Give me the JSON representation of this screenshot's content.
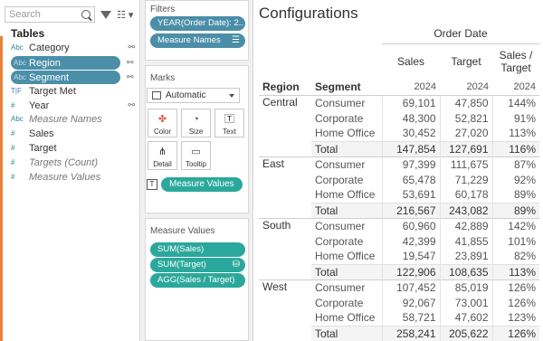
{
  "data_pane": {
    "search_placeholder": "Search",
    "tables_title": "Tables",
    "fields": [
      {
        "type": "Abc",
        "name": "Category",
        "selected": false,
        "italic": false
      },
      {
        "type": "Abc",
        "name": "Region",
        "selected": true,
        "italic": false
      },
      {
        "type": "Abc",
        "name": "Segment",
        "selected": true,
        "italic": false
      },
      {
        "type": "T|F",
        "name": "Target Met",
        "selected": false,
        "italic": false
      },
      {
        "type": "#",
        "name": "Year",
        "selected": false,
        "italic": false
      },
      {
        "type": "Abc",
        "name": "Measure Names",
        "selected": false,
        "italic": true
      },
      {
        "type": "#",
        "name": "Sales",
        "selected": false,
        "italic": false
      },
      {
        "type": "#",
        "name": "Target",
        "selected": false,
        "italic": false
      },
      {
        "type": "#",
        "name": "Targets (Count)",
        "selected": false,
        "italic": true
      },
      {
        "type": "#",
        "name": "Measure Values",
        "selected": false,
        "italic": true
      }
    ]
  },
  "filters": {
    "title": "Filters",
    "items": [
      "YEAR(Order Date): 2..",
      "Measure Names"
    ]
  },
  "marks": {
    "title": "Marks",
    "mark_type": "Automatic",
    "buttons": [
      "Color",
      "Size",
      "Text",
      "Detail",
      "Tooltip"
    ],
    "text_pill": "Measure Values"
  },
  "measure_values": {
    "title": "Measure Values",
    "items": [
      "SUM(Sales)",
      "SUM(Target)",
      "AGG(Sales / Target)"
    ]
  },
  "view": {
    "title": "Configurations",
    "header_group": "Order Date",
    "row_headers": [
      "Region",
      "Segment"
    ],
    "columns": [
      "Sales",
      "Target",
      "Sales /\nTarget"
    ],
    "year": "2024",
    "regions": [
      {
        "name": "Central",
        "rows": [
          {
            "segment": "Consumer",
            "sales": "69,101",
            "target": "47,850",
            "ratio": "144%"
          },
          {
            "segment": "Corporate",
            "sales": "48,300",
            "target": "52,821",
            "ratio": "91%"
          },
          {
            "segment": "Home Office",
            "sales": "30,452",
            "target": "27,020",
            "ratio": "113%"
          },
          {
            "segment": "Total",
            "sales": "147,854",
            "target": "127,691",
            "ratio": "116%"
          }
        ]
      },
      {
        "name": "East",
        "rows": [
          {
            "segment": "Consumer",
            "sales": "97,399",
            "target": "111,675",
            "ratio": "87%"
          },
          {
            "segment": "Corporate",
            "sales": "65,478",
            "target": "71,229",
            "ratio": "92%"
          },
          {
            "segment": "Home Office",
            "sales": "53,691",
            "target": "60,178",
            "ratio": "89%"
          },
          {
            "segment": "Total",
            "sales": "216,567",
            "target": "243,082",
            "ratio": "89%"
          }
        ]
      },
      {
        "name": "South",
        "rows": [
          {
            "segment": "Consumer",
            "sales": "60,960",
            "target": "42,889",
            "ratio": "142%"
          },
          {
            "segment": "Corporate",
            "sales": "42,399",
            "target": "41,855",
            "ratio": "101%"
          },
          {
            "segment": "Home Office",
            "sales": "19,547",
            "target": "23,891",
            "ratio": "82%"
          },
          {
            "segment": "Total",
            "sales": "122,906",
            "target": "108,635",
            "ratio": "113%"
          }
        ]
      },
      {
        "name": "West",
        "rows": [
          {
            "segment": "Consumer",
            "sales": "107,452",
            "target": "85,019",
            "ratio": "126%"
          },
          {
            "segment": "Corporate",
            "sales": "92,067",
            "target": "73,001",
            "ratio": "126%"
          },
          {
            "segment": "Home Office",
            "sales": "58,721",
            "target": "47,602",
            "ratio": "123%"
          },
          {
            "segment": "Total",
            "sales": "258,241",
            "target": "205,622",
            "ratio": "126%"
          }
        ]
      }
    ]
  },
  "colors": {
    "accent": "#e8823a",
    "pill_blue": "#4b8ea8",
    "pill_green": "#2ba89c"
  }
}
